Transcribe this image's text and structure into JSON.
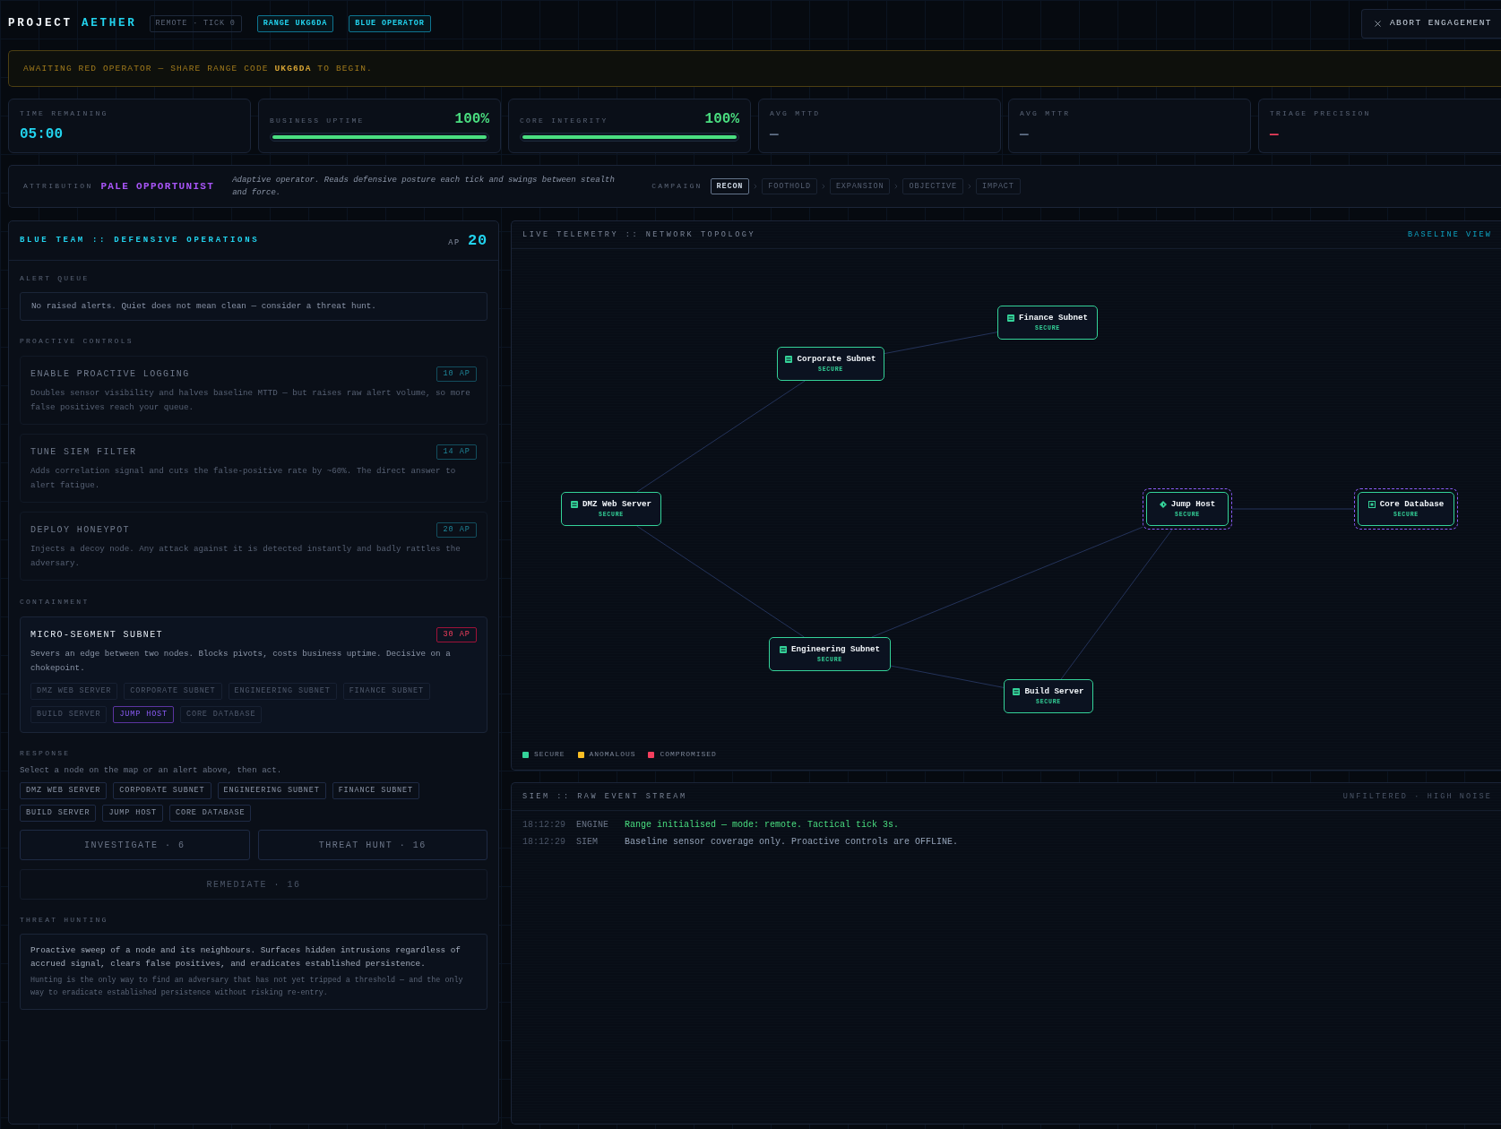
{
  "header": {
    "title": "PROJECT",
    "title_accent": "AETHER",
    "badges": [
      {
        "label": "REMOTE · TICK 0",
        "kind": "muted"
      },
      {
        "label": "RANGE UKG6DA",
        "kind": "accent"
      },
      {
        "label": "BLUE OPERATOR",
        "kind": "accent"
      }
    ],
    "abort_button": "ABORT ENGAGEMENT"
  },
  "banner": "AWAITING RED OPERATOR — SHARE RANGE CODE **UKG6DA** TO BEGIN.",
  "metrics": [
    {
      "kind": "value",
      "label": "TIME REMAINING",
      "value": "05:00",
      "color": "#22d3ee"
    },
    {
      "kind": "meter",
      "label": "BUSINESS UPTIME",
      "value": "100%",
      "level": 1,
      "color": "#4ade80"
    },
    {
      "kind": "meter",
      "label": "CORE INTEGRITY",
      "value": "100%",
      "level": 1,
      "color": "#4ade80"
    },
    {
      "kind": "value",
      "label": "AVG MTTD",
      "value": "—",
      "color": "#64748b"
    },
    {
      "kind": "value",
      "label": "AVG MTTR",
      "value": "—",
      "color": "#64748b"
    },
    {
      "kind": "value",
      "label": "TRIAGE PRECISION",
      "value": "—",
      "color": "#f43f5e"
    }
  ],
  "attribution": {
    "label": "ATTRIBUTION",
    "name": "PALE OPPORTUNIST",
    "description": "Adaptive operator. Reads defensive posture each tick and swings between stealth and force.",
    "campaign_label": "CAMPAIGN",
    "stages": [
      {
        "label": "RECON",
        "selected": true
      },
      {
        "label": "FOOTHOLD",
        "selected": false
      },
      {
        "label": "EXPANSION",
        "selected": false
      },
      {
        "label": "OBJECTIVE",
        "selected": false
      },
      {
        "label": "IMPACT",
        "selected": false
      }
    ]
  },
  "blue_team": {
    "title": "BLUE TEAM :: DEFENSIVE OPERATIONS",
    "ap_label": "AP",
    "ap_value": "20",
    "alert_queue": {
      "heading": "ALERT QUEUE",
      "message": "No raised alerts. Quiet does not mean clean — consider a threat hunt."
    },
    "proactive_controls": {
      "heading": "PROACTIVE CONTROLS",
      "items": [
        {
          "title": "ENABLE PROACTIVE LOGGING",
          "cost": "10 AP",
          "description": "Doubles sensor visibility and halves baseline MTTD — but raises raw alert volume, so more false positives reach your queue.",
          "disabled": true,
          "unaffordable": false
        },
        {
          "title": "TUNE SIEM FILTER",
          "cost": "14 AP",
          "description": "Adds correlation signal and cuts the false-positive rate by ~60%. The direct answer to alert fatigue.",
          "disabled": true,
          "unaffordable": false
        },
        {
          "title": "DEPLOY HONEYPOT",
          "cost": "20 AP",
          "description": "Injects a decoy node. Any attack against it is detected instantly and badly rattles the adversary.",
          "disabled": true,
          "unaffordable": false
        }
      ]
    },
    "containment": {
      "heading": "CONTAINMENT",
      "items": [
        {
          "title": "MICRO-SEGMENT SUBNET",
          "cost": "30 AP",
          "description": "Severs an edge between two nodes. Blocks pivots, costs business uptime. Decisive on a chokepoint.",
          "disabled": false,
          "unaffordable": true,
          "targets": [
            {
              "label": "DMZ WEB SERVER",
              "highlighted": false
            },
            {
              "label": "CORPORATE SUBNET",
              "highlighted": false
            },
            {
              "label": "ENGINEERING SUBNET",
              "highlighted": false
            },
            {
              "label": "FINANCE SUBNET",
              "highlighted": false
            },
            {
              "label": "BUILD SERVER",
              "highlighted": false
            },
            {
              "label": "JUMP HOST",
              "highlighted": true
            },
            {
              "label": "CORE DATABASE",
              "highlighted": false
            }
          ]
        }
      ]
    },
    "response": {
      "heading": "RESPONSE",
      "hint": "Select a node on the map or an alert above, then act.",
      "targets": [
        {
          "label": "DMZ WEB SERVER",
          "selected": false
        },
        {
          "label": "CORPORATE SUBNET",
          "selected": false
        },
        {
          "label": "ENGINEERING SUBNET",
          "selected": false
        },
        {
          "label": "FINANCE SUBNET",
          "selected": false
        },
        {
          "label": "BUILD SERVER",
          "selected": false
        },
        {
          "label": "JUMP HOST",
          "selected": false
        },
        {
          "label": "CORE DATABASE",
          "selected": false
        }
      ],
      "actions": [
        {
          "label": "INVESTIGATE · 6",
          "disabled": false
        },
        {
          "label": "THREAT HUNT · 16",
          "disabled": false
        },
        {
          "label": "REMEDIATE · 16",
          "disabled": true
        }
      ]
    },
    "threat_hunting": {
      "heading": "THREAT HUNTING",
      "summary": "Proactive sweep of a node and its neighbours. Surfaces hidden intrusions regardless of accrued signal, clears false positives, and eradicates established persistence.",
      "note": "Hunting is the only way to find an adversary that has not yet tripped a threshold — and the only way to eradicate established persistence without risking re-entry."
    }
  },
  "topology": {
    "title": "LIVE TELEMETRY :: NETWORK TOPOLOGY",
    "view_label": "BASELINE VIEW",
    "nodes": [
      {
        "name": "Finance Subnet",
        "status": "SECURE",
        "kind": "server",
        "color": "#34d399",
        "ringed": false
      },
      {
        "name": "Corporate Subnet",
        "status": "SECURE",
        "kind": "server",
        "color": "#34d399",
        "ringed": false
      },
      {
        "name": "DMZ Web Server",
        "status": "SECURE",
        "kind": "server",
        "color": "#34d399",
        "ringed": false
      },
      {
        "name": "Jump Host",
        "status": "SECURE",
        "kind": "gateway",
        "color": "#34d399",
        "ringed": true
      },
      {
        "name": "Core Database",
        "status": "SECURE",
        "kind": "vault",
        "color": "#34d399",
        "ringed": true
      },
      {
        "name": "Engineering Subnet",
        "status": "SECURE",
        "kind": "server",
        "color": "#34d399",
        "ringed": false
      },
      {
        "name": "Build Server",
        "status": "SECURE",
        "kind": "server",
        "color": "#34d399",
        "ringed": false
      }
    ],
    "legend": [
      {
        "label": "SECURE",
        "color": "#34d399"
      },
      {
        "label": "ANOMALOUS",
        "color": "#fbbf24"
      },
      {
        "label": "COMPROMISED",
        "color": "#f43f5e"
      }
    ]
  },
  "siem": {
    "title": "SIEM :: RAW EVENT STREAM",
    "filter_label": "UNFILTERED · HIGH NOISE",
    "events": [
      {
        "time": "18:12:29",
        "source": "ENGINE",
        "message": "Range initialised — mode: remote. Tactical tick 3s.",
        "color": "#4ade80"
      },
      {
        "time": "18:12:29",
        "source": "SIEM",
        "message": "Baseline sensor coverage only. Proactive controls are OFFLINE.",
        "color": "#94a3b8"
      }
    ]
  }
}
